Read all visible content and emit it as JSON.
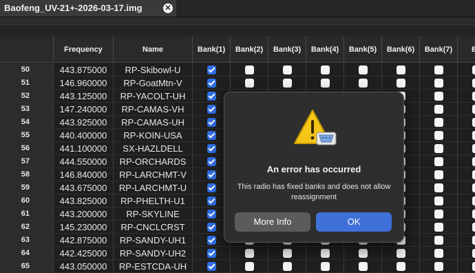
{
  "tab": {
    "title": "Baofeng_UV-21+-2026-03-17.img",
    "close_glyph": "✕"
  },
  "table": {
    "headers": {
      "frequency": "Frequency",
      "name": "Name",
      "banks": [
        "Bank(1)",
        "Bank(2)",
        "Bank(3)",
        "Bank(4)",
        "Bank(5)",
        "Bank(6)",
        "Bank(7)",
        "Ba"
      ]
    },
    "rows": [
      {
        "num": "50",
        "freq": "443.875000",
        "name": "RP-Skibowl-U"
      },
      {
        "num": "51",
        "freq": "146.960000",
        "name": "RP-GoatMtn-V"
      },
      {
        "num": "52",
        "freq": "443.125000",
        "name": "RP-YACOLT-UH"
      },
      {
        "num": "53",
        "freq": "147.240000",
        "name": "RP-CAMAS-VH"
      },
      {
        "num": "54",
        "freq": "443.925000",
        "name": "RP-CAMAS-UH"
      },
      {
        "num": "55",
        "freq": "440.400000",
        "name": "RP-KOIN-USA"
      },
      {
        "num": "56",
        "freq": "441.100000",
        "name": "SX-HAZLDELL"
      },
      {
        "num": "57",
        "freq": "444.550000",
        "name": "RP-ORCHARDS"
      },
      {
        "num": "58",
        "freq": "146.840000",
        "name": "RP-LARCHMT-V"
      },
      {
        "num": "59",
        "freq": "443.675000",
        "name": "RP-LARCHMT-U"
      },
      {
        "num": "60",
        "freq": "443.825000",
        "name": "RP-PHELTH-U1"
      },
      {
        "num": "61",
        "freq": "443.200000",
        "name": "RP-SKYLINE"
      },
      {
        "num": "62",
        "freq": "145.230000",
        "name": "RP-CNCLCRST"
      },
      {
        "num": "63",
        "freq": "442.875000",
        "name": "RP-SANDY-UH1"
      },
      {
        "num": "64",
        "freq": "442.425000",
        "name": "RP-SANDY-UH2"
      },
      {
        "num": "65",
        "freq": "443.050000",
        "name": "RP-ESTCDA-UH"
      }
    ]
  },
  "dialog": {
    "title": "An error has occurred",
    "message": "This radio has fixed banks and does not allow reassignment",
    "more_info_label": "More Info",
    "ok_label": "OK"
  },
  "colors": {
    "accent": "#3f6fd9",
    "checkbox_on": "#2f6fe6",
    "warning": "#f5c518"
  },
  "icons": {
    "dialog": "warning-serial-port-icon"
  }
}
